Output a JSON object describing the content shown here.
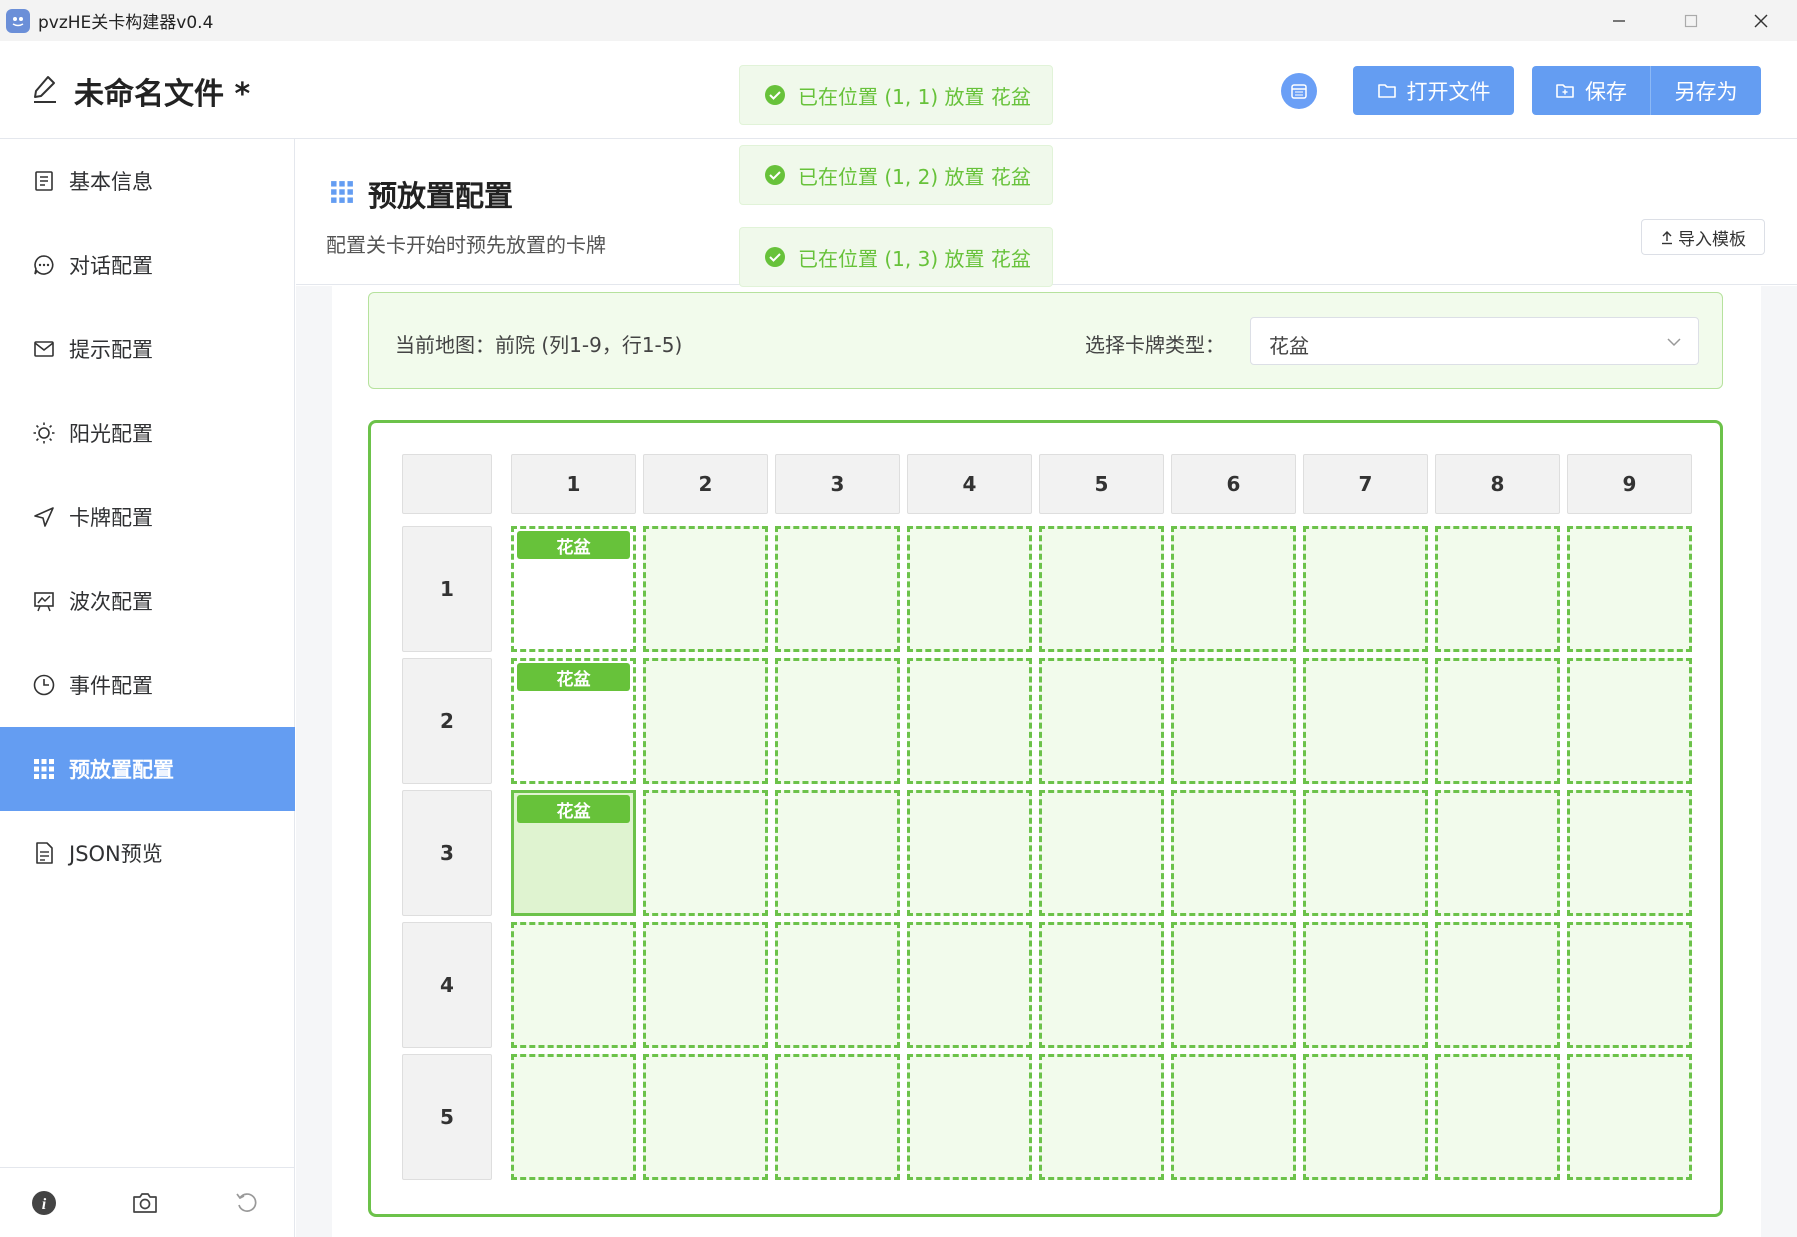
{
  "window": {
    "title": "pvzHE关卡构建器v0.4"
  },
  "header": {
    "file_title": "未命名文件 *",
    "open_label": "打开文件",
    "save_label": "保存",
    "save_as_label": "另存为"
  },
  "sidebar": {
    "items": [
      {
        "label": "基本信息",
        "icon": "document-icon"
      },
      {
        "label": "对话配置",
        "icon": "chat-icon"
      },
      {
        "label": "提示配置",
        "icon": "mail-icon"
      },
      {
        "label": "阳光配置",
        "icon": "sun-icon"
      },
      {
        "label": "卡牌配置",
        "icon": "send-icon"
      },
      {
        "label": "波次配置",
        "icon": "presentation-icon"
      },
      {
        "label": "事件配置",
        "icon": "clock-icon"
      },
      {
        "label": "预放置配置",
        "icon": "grid-icon",
        "active": true
      },
      {
        "label": "JSON预览",
        "icon": "file-text-icon"
      }
    ],
    "bottom_icons": [
      "info-icon",
      "camera-icon",
      "refresh-icon"
    ]
  },
  "page": {
    "title": "预放置配置",
    "subtitle": "配置关卡开始时预先放置的卡牌",
    "import_label": "导入模板"
  },
  "map_info": {
    "map_text": "当前地图：前院 (列1-9，行1-5)",
    "type_label": "选择卡牌类型：",
    "type_value": "花盆"
  },
  "grid": {
    "columns": [
      "1",
      "2",
      "3",
      "4",
      "5",
      "6",
      "7",
      "8",
      "9"
    ],
    "rows": [
      "1",
      "2",
      "3",
      "4",
      "5"
    ],
    "placements": [
      {
        "row": 1,
        "col": 1,
        "label": "花盆"
      },
      {
        "row": 2,
        "col": 1,
        "label": "花盆"
      },
      {
        "row": 3,
        "col": 1,
        "label": "花盆",
        "selected": true
      }
    ]
  },
  "toasts": [
    "已在位置 (1, 1) 放置 花盆",
    "已在位置 (1, 2) 放置 花盆",
    "已在位置 (1, 3) 放置 花盆"
  ],
  "colors": {
    "primary": "#649df2",
    "success": "#67c23a",
    "grid_border": "#6cc24a"
  }
}
